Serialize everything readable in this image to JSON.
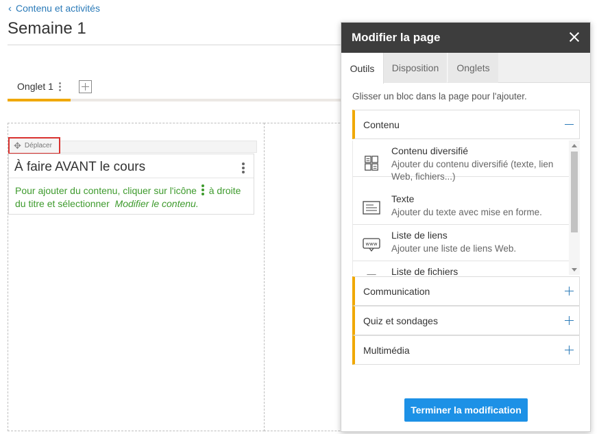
{
  "breadcrumb": {
    "back_label": "Contenu et activités"
  },
  "page": {
    "title": "Semaine 1"
  },
  "tabs": {
    "items": [
      {
        "label": "Onglet 1"
      }
    ]
  },
  "block": {
    "move_label": "Déplacer",
    "title": "À faire AVANT le cours",
    "hint_before": "Pour ajouter du contenu, cliquer sur l'icône",
    "hint_after": "à droite du titre et sélectionner",
    "hint_action": "Modifier le contenu."
  },
  "panel": {
    "title": "Modifier la page",
    "tabs": [
      {
        "label": "Outils"
      },
      {
        "label": "Disposition"
      },
      {
        "label": "Onglets"
      }
    ],
    "intro": "Glisser un bloc dans la page pour l'ajouter.",
    "sections": [
      {
        "label": "Contenu",
        "state": "expanded"
      },
      {
        "label": "Communication",
        "state": "collapsed"
      },
      {
        "label": "Quiz et sondages",
        "state": "collapsed"
      },
      {
        "label": "Multimédia",
        "state": "collapsed"
      }
    ],
    "tools": [
      {
        "name": "Contenu diversifié",
        "desc": "Ajouter du contenu diversifié (texte, lien Web, fichiers...)",
        "icon": "mixed-content-icon"
      },
      {
        "name": "Texte",
        "desc": "Ajouter du texte avec mise en forme.",
        "icon": "text-icon"
      },
      {
        "name": "Liste de liens",
        "desc": "Ajouter une liste de liens Web.",
        "icon": "www-link-icon"
      },
      {
        "name": "Liste de fichiers",
        "desc": "",
        "icon": "files-icon"
      }
    ],
    "finish_label": "Terminer la modification"
  },
  "colors": {
    "accent": "#f0a800",
    "link": "#2a7ab8",
    "primary_button": "#1d91e6",
    "hint_green": "#3d9a2c",
    "highlight_red": "#d9322f"
  }
}
